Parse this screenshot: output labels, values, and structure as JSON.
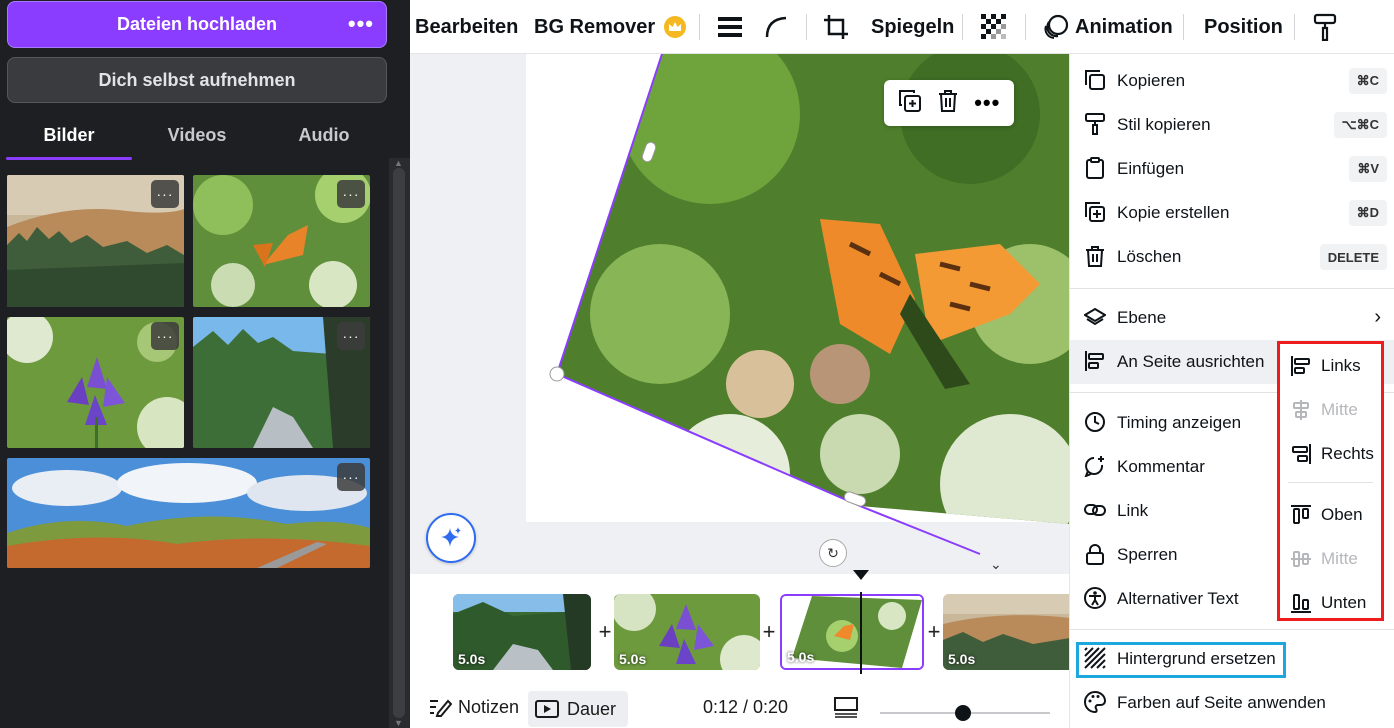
{
  "left_panel": {
    "upload_label": "Dateien hochladen",
    "upload_more": "•••",
    "record_label": "Dich selbst aufnehmen",
    "tabs": [
      {
        "label": "Bilder",
        "active": true
      },
      {
        "label": "Videos",
        "active": false
      },
      {
        "label": "Audio",
        "active": false
      }
    ],
    "thumbnail_more": "···",
    "thumbnails": [
      "mountain-forest-meadow",
      "orange-butterfly-on-flower",
      "purple-bellflower",
      "forest-river-valley",
      "panoramic-hills-sky"
    ]
  },
  "toolbar": {
    "edit": "Bearbeiten",
    "bg_remover": "BG Remover",
    "crown_icon": "crown-icon",
    "mirror": "Spiegeln",
    "animation": "Animation",
    "position": "Position"
  },
  "timeline": {
    "clips": [
      {
        "duration": "5.0s",
        "image": "forest-river-valley"
      },
      {
        "duration": "5.0s",
        "image": "purple-bellflower"
      },
      {
        "duration": "5.0s",
        "image": "orange-butterfly-on-flower",
        "selected": true
      },
      {
        "duration": "5.0s",
        "image": "mountain-forest-meadow"
      }
    ],
    "plus": "+"
  },
  "bottom_bar": {
    "notes": "Notizen",
    "duration": "Dauer",
    "time": "0:12 / 0:20"
  },
  "context_menu": {
    "items": [
      {
        "label": "Kopieren",
        "shortcut": "⌘C",
        "icon": "copy-icon"
      },
      {
        "label": "Stil kopieren",
        "shortcut": "⌥⌘C",
        "icon": "paint-roller-icon"
      },
      {
        "label": "Einfügen",
        "shortcut": "⌘V",
        "icon": "clipboard-icon"
      },
      {
        "label": "Kopie erstellen",
        "shortcut": "⌘D",
        "icon": "duplicate-icon"
      },
      {
        "label": "Löschen",
        "shortcut": "DELETE",
        "icon": "trash-icon"
      },
      {
        "label": "Ebene",
        "icon": "layers-icon"
      },
      {
        "label": "An Seite ausrichten",
        "icon": "align-left-icon"
      },
      {
        "label": "Timing anzeigen",
        "icon": "clock-icon"
      },
      {
        "label": "Kommentar",
        "icon": "comment-icon"
      },
      {
        "label": "Link",
        "icon": "link-icon"
      },
      {
        "label": "Sperren",
        "icon": "lock-icon"
      },
      {
        "label": "Alternativer Text",
        "icon": "accessibility-icon"
      },
      {
        "label": "Hintergrund ersetzen",
        "icon": "hatch-pattern-icon"
      },
      {
        "label": "Farben auf Seite anwenden",
        "icon": "palette-icon"
      }
    ],
    "submenu": [
      {
        "label": "Links",
        "enabled": true
      },
      {
        "label": "Mitte",
        "enabled": false
      },
      {
        "label": "Rechts",
        "enabled": true
      },
      {
        "label": "Oben",
        "enabled": true
      },
      {
        "label": "Mitte",
        "enabled": false
      },
      {
        "label": "Unten",
        "enabled": true
      }
    ]
  },
  "colors": {
    "brand_purple": "#8b3dff",
    "highlight_red": "#ee1c1c",
    "highlight_blue": "#1ea7dd"
  }
}
